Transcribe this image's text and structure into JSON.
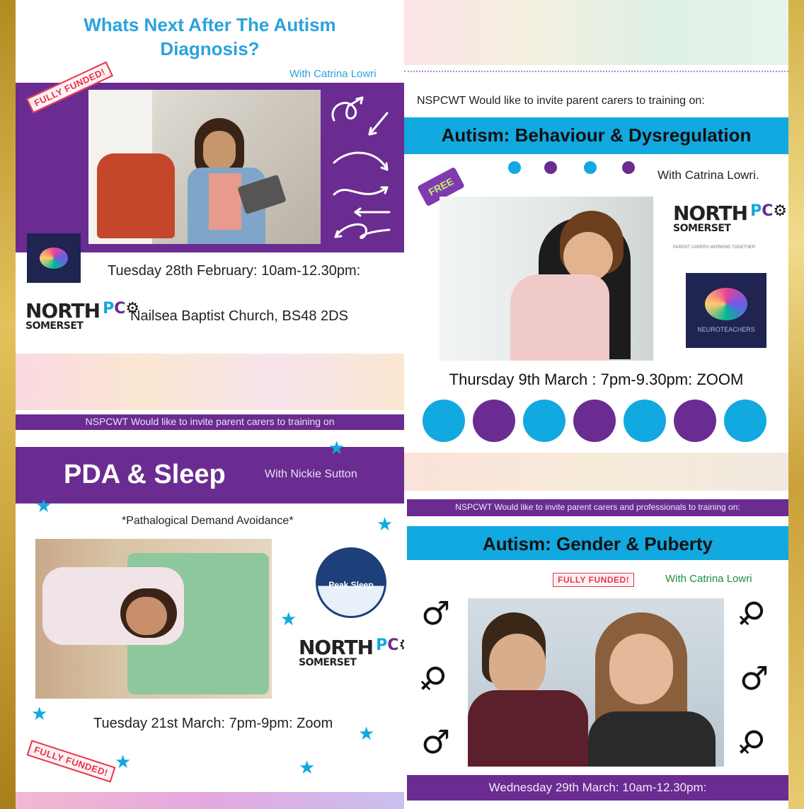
{
  "flyer1": {
    "title_line1": "Whats Next After The Autism",
    "title_line2": "Diagnosis?",
    "presenter": "With Catrina  Lowri",
    "badge": "FULLY FUNDED!",
    "date": "Tuesday 28th February:  10am-12.30pm:",
    "venue": "Nailsea Baptist Church, BS48 2DS"
  },
  "flyer2": {
    "intro": "NSPCWT Would like to invite parent carers to training on:",
    "title": "Autism: Behaviour & Dysregulation",
    "presenter": "With Catrina Lowri.",
    "badge": "FREE",
    "date": "Thursday 9th March : 7pm-9.30pm: ZOOM",
    "logo_text": "NEUROTEACHERS"
  },
  "flyer3": {
    "intro": "NSPCWT Would like to invite parent carers to training on",
    "title": "PDA & Sleep",
    "presenter": "With Nickie Sutton",
    "subtitle": "*Pathalogical Demand Avoidance*",
    "logo_text": "Peak Sleep",
    "date": "Tuesday 21st March: 7pm-9pm: Zoom",
    "badge": "FULLY FUNDED!"
  },
  "flyer4": {
    "intro": "NSPCWT Would like to invite parent carers and professionals  to training on:",
    "title": "Autism: Gender & Puberty",
    "badge": "FULLY FUNDED!",
    "presenter": "With Catrina  Lowri",
    "date": "Wednesday 29th March:  10am-12.30pm:"
  },
  "logos": {
    "north": "NORTH",
    "somerset": "SOMERSET",
    "tagline": "PARENT CARERS WORKING TOGETHER"
  },
  "colors": {
    "purple": "#6a2c91",
    "blue": "#12a8e0",
    "gold": "#c9a13a"
  },
  "icons": [
    "arrow-doodle-icon",
    "star-icon",
    "male-symbol-icon",
    "female-symbol-icon",
    "brain-icon"
  ]
}
